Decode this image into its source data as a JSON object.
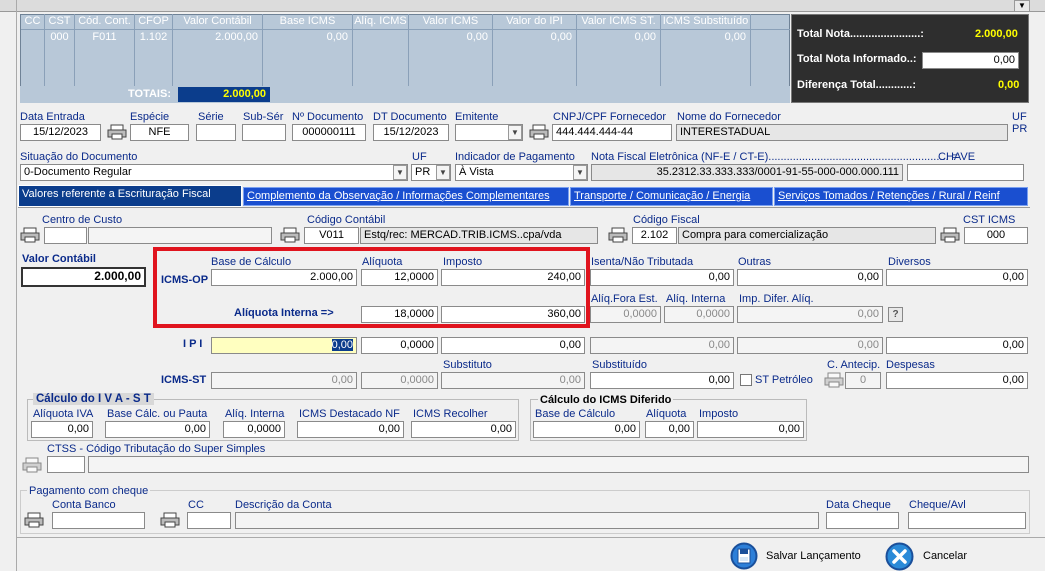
{
  "grid": {
    "columns": [
      "CC",
      "CST",
      "Cód. Cont.",
      "CFOP",
      "Valor Contábil",
      "Base ICMS",
      "Alíq. ICMS",
      "Valor ICMS",
      "Valor do IPI",
      "Valor ICMS ST.",
      "ICMS Substituído"
    ],
    "row": [
      "",
      "000",
      "F011",
      "1.102",
      "2.000,00",
      "0,00",
      "",
      "0,00",
      "0,00",
      "0,00",
      "0,00"
    ],
    "totais_label": "TOTAIS:",
    "totais_value": "2.000,00"
  },
  "totals": {
    "total_nota_label": "Total Nota.......................:",
    "total_nota_value": "2.000,00",
    "total_informado_label": "Total Nota Informado..:",
    "total_informado_value": "0,00",
    "diferenca_label": "Diferença Total............:",
    "diferenca_value": "0,00"
  },
  "doc": {
    "data_entrada_label": "Data Entrada",
    "data_entrada": "15/12/2023",
    "especie_label": "Espécie",
    "especie": "NFE",
    "serie_label": "Série",
    "serie": "",
    "subser_label": "Sub-Sér",
    "subser": "",
    "ndoc_label": "Nº Documento",
    "ndoc": "000000111",
    "dtdoc_label": "DT Documento",
    "dtdoc": "15/12/2023",
    "emitente_label": "Emitente",
    "emitente": "",
    "cnpj_label": "CNPJ/CPF Fornecedor",
    "cnpj": "444.444.444-44",
    "nome_label": "Nome do Fornecedor",
    "nome": "INTERESTADUAL",
    "uf_top_label": "UF",
    "uf_top": "PR",
    "situacao_label": "Situação do Documento",
    "situacao": "0-Documento Regular",
    "uf_label": "UF",
    "uf": "PR",
    "indpag_label": "Indicador de Pagamento",
    "indpag": "À Vista",
    "nfe_label": "Nota Fiscal Eletrônica (NF-E / CT-E)...........................................................  =",
    "nfe": "35.2312.33.333.333/0001-91-55-000-000.000.111",
    "chave_label": "CHAVE",
    "chave": ""
  },
  "tabs": [
    "Valores referente a Escrituração Fiscal",
    "Complemento da Observação / Informações Complementares",
    "Transporte / Comunicação / Energia",
    "Serviços Tomados / Retenções / Rural / Reinf"
  ],
  "fiscal": {
    "centro_custo_label": "Centro de Custo",
    "centro_custo": "",
    "centro_custo_desc": "",
    "cod_contabil_label": "Código Contábil",
    "cod_contabil": "V011",
    "cod_contabil_desc": "Estq/rec: MERCAD.TRIB.ICMS..cpa/vda",
    "cod_fiscal_label": "Código Fiscal",
    "cod_fiscal": "2.102",
    "cod_fiscal_desc": "Compra para comercialização",
    "cst_label": "CST ICMS",
    "cst": "000",
    "valor_contabil_label": "Valor Contábil",
    "valor_contabil": "2.000,00",
    "base_calculo_label": "Base de Cálculo",
    "aliquota_label": "Alíquota",
    "imposto_label": "Imposto",
    "icms_op_label": "ICMS-OP",
    "icms_op_base": "2.000,00",
    "icms_op_aliq": "12,0000",
    "icms_op_imposto": "240,00",
    "aliq_interna_label": "Alíquota Interna =>",
    "aliq_interna": "18,0000",
    "aliq_interna_imposto": "360,00",
    "isenta_label": "Isenta/Não Tributada",
    "isenta": "0,00",
    "outras_label": "Outras",
    "outras": "0,00",
    "diversos_label": "Diversos",
    "diversos": "0,00",
    "aliq_fora_label": "Alíq.Fora Est.",
    "aliq_fora": "0,0000",
    "aliq_int2_label": "Alíq. Interna",
    "aliq_int2": "0,0000",
    "imp_difer_label": "Imp. Difer. Alíq.",
    "imp_difer": "0,00",
    "help_glyph": "?",
    "ipi_label": "I P I",
    "ipi_base": "0,00",
    "ipi_aliq": "0,0000",
    "ipi_imposto": "0,00",
    "ipi_isenta": "0,00",
    "ipi_outras": "0,00",
    "ipi_diversos": "0,00",
    "substituto_label": "Substituto",
    "substituido_label": "Substituído",
    "icms_st_label": "ICMS-ST",
    "st_base": "0,00",
    "st_aliq": "0,0000",
    "st_substituto": "0,00",
    "st_substituido": "0,00",
    "st_petroleo_label": "ST Petróleo",
    "c_antecip_label": "C. Antecip.",
    "c_antecip": "0",
    "despesas_label": "Despesas",
    "despesas": "0,00"
  },
  "iva": {
    "title": "Cálculo  do  I V A - S T",
    "aliq_iva_label": "Alíquota IVA",
    "aliq_iva": "0,00",
    "base_pauta_label": "Base Cálc. ou Pauta",
    "base_pauta": "0,00",
    "aliq_interna_label": "Alíq. Interna",
    "aliq_interna": "0,0000",
    "destacado_label": "ICMS Destacado NF",
    "destacado": "0,00",
    "recolher_label": "ICMS Recolher",
    "recolher": "0,00"
  },
  "diferido": {
    "title": "Cálculo do ICMS Diferido",
    "base_label": "Base de Cálculo",
    "base": "0,00",
    "aliq_label": "Alíquota",
    "aliq": "0,00",
    "imposto_label": "Imposto",
    "imposto": "0,00"
  },
  "ctss": {
    "label": "CTSS - Código Tributação do Super Simples",
    "code": "",
    "desc": ""
  },
  "cheque": {
    "title": "Pagamento com cheque",
    "conta_banco_label": "Conta  Banco",
    "conta_banco": "",
    "cc_label": "CC",
    "cc": "",
    "desc_conta_label": "Descrição da Conta",
    "desc_conta": "",
    "data_cheque_label": "Data Cheque",
    "data_cheque": "",
    "cheque_avl_label": "Cheque/Avl",
    "cheque_avl": ""
  },
  "buttons": {
    "salvar": "Salvar Lançamento",
    "cancelar": "Cancelar"
  },
  "colors": {
    "navy": "#0b3d8c",
    "highlight": "#ffff00",
    "red_box": "#e0141e",
    "grid_bg": "#b8c8d8"
  }
}
